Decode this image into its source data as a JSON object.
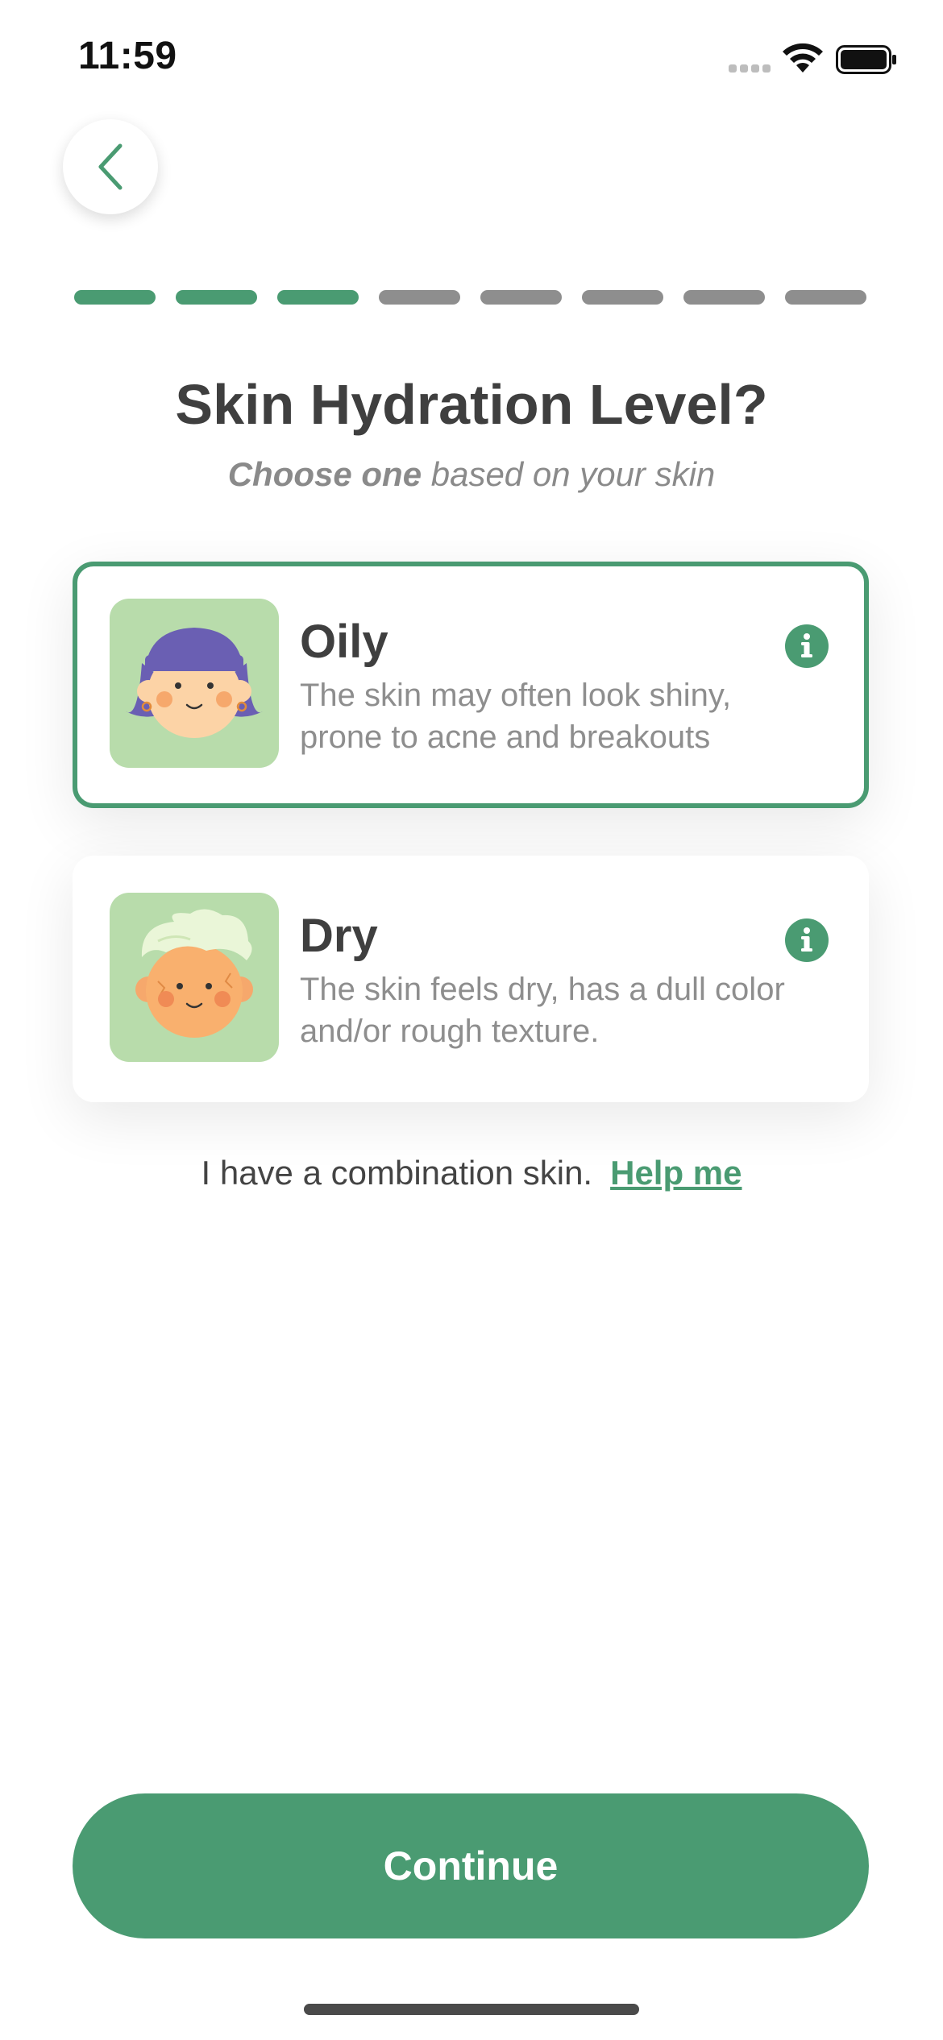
{
  "status_bar": {
    "time": "11:59"
  },
  "progress": {
    "total_steps": 8,
    "completed_steps": 3,
    "active_color": "#4a9b72",
    "inactive_color": "#8e8e8e"
  },
  "header": {
    "title": "Skin Hydration Level?",
    "subtitle_emphasis": "Choose one",
    "subtitle_rest": " based on your skin"
  },
  "options": [
    {
      "title": "Oily",
      "description": "The skin may often look shiny, prone to acne and breakouts",
      "selected": true,
      "avatar": "oily-face-avatar",
      "icon": "info-icon"
    },
    {
      "title": "Dry",
      "description": "The skin feels dry, has a dull color and/or rough texture.",
      "selected": false,
      "avatar": "dry-face-avatar",
      "icon": "info-icon"
    }
  ],
  "combination": {
    "text": "I have a combination skin.",
    "link": "Help me"
  },
  "footer": {
    "continue_label": "Continue"
  },
  "colors": {
    "accent": "#4a9b72",
    "avatar_bg": "#b8dcab"
  }
}
